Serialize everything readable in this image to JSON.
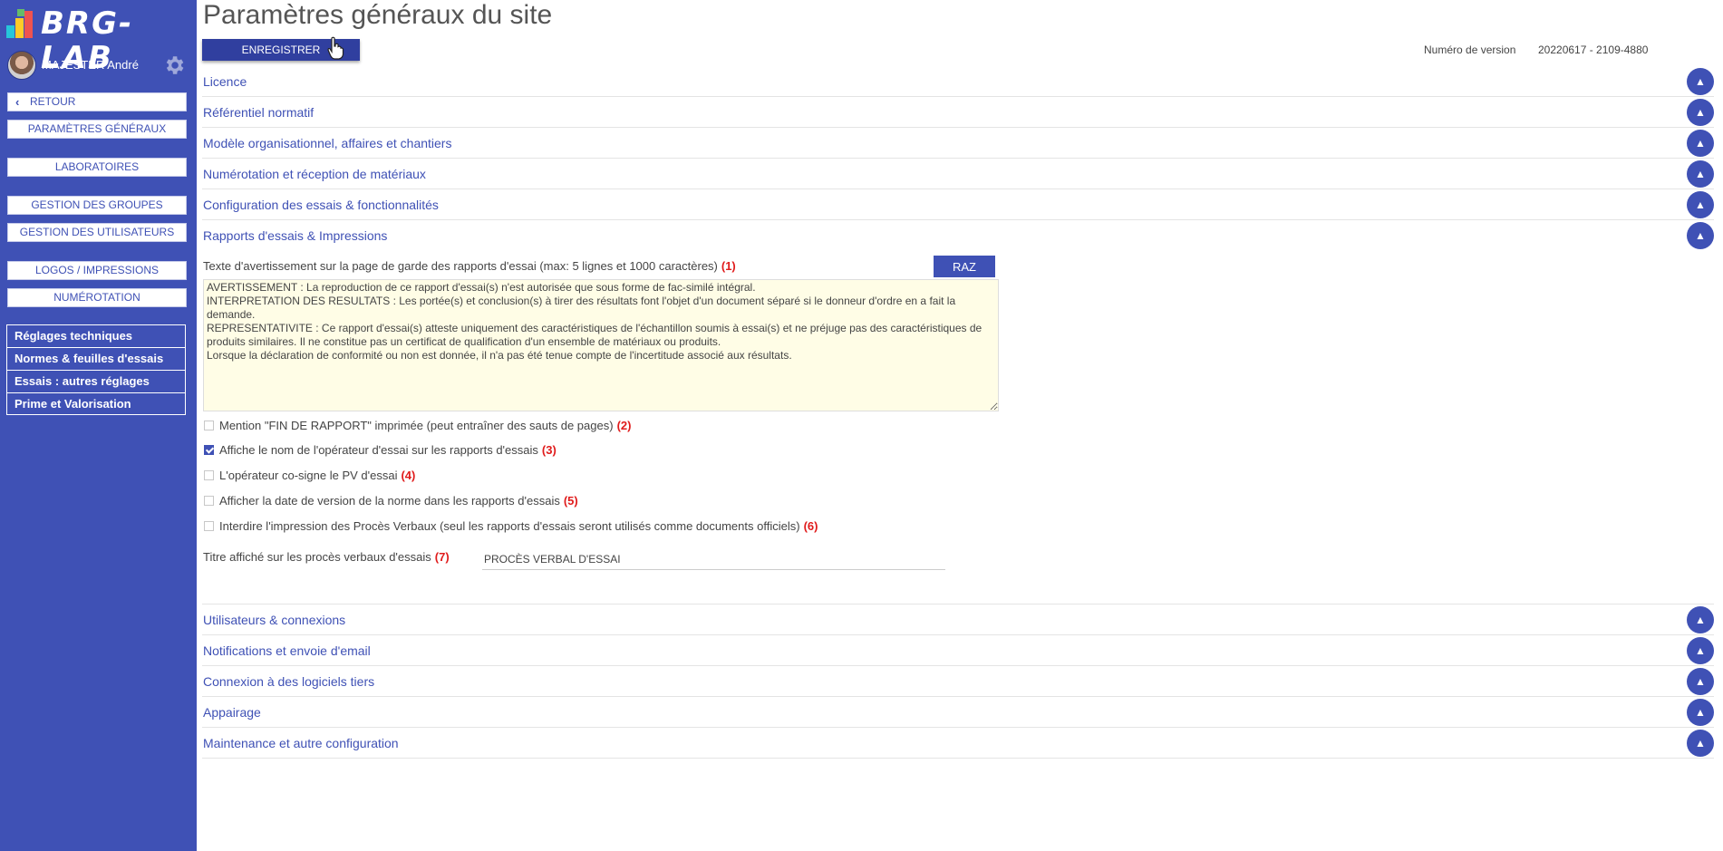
{
  "sidebar": {
    "logo_text": "BRG-LAB",
    "user_name": "MAJESTER André",
    "back_label": "RETOUR",
    "buttons": [
      {
        "label": "PARAMÈTRES GÉNÉRAUX"
      },
      {
        "label": "LABORATOIRES"
      },
      {
        "label": "GESTION DES GROUPES"
      },
      {
        "label": "GESTION DES UTILISATEURS"
      },
      {
        "label": "LOGOS / IMPRESSIONS"
      },
      {
        "label": "NUMÉROTATION"
      }
    ],
    "box_items": [
      {
        "label": "Réglages techniques"
      },
      {
        "label": "Normes & feuilles d'essais"
      },
      {
        "label": "Essais : autres réglages"
      },
      {
        "label": "Prime et Valorisation"
      }
    ]
  },
  "header": {
    "title": "Paramètres généraux du site",
    "save_label": "ENREGISTRER",
    "version_label": "Numéro de version",
    "version_value": "20220617 - 2109-4880"
  },
  "sections_top": [
    {
      "title": "Licence"
    },
    {
      "title": "Référentiel normatif"
    },
    {
      "title": "Modèle organisationnel, affaires et chantiers"
    },
    {
      "title": "Numérotation et réception de matériaux"
    },
    {
      "title": "Configuration des essais & fonctionnalités"
    }
  ],
  "open_section": {
    "title": "Rapports d'essais & Impressions",
    "warning_label": "Texte d'avertissement sur la page de garde des rapports d'essai (max: 5 lignes et 1000 caractères)",
    "warning_note": "(1)",
    "raz_label": "RAZ",
    "warning_text": "AVERTISSEMENT : La reproduction de ce rapport d'essai(s) n'est autorisée que sous forme de fac-similé intégral.\nINTERPRETATION DES RESULTATS : Les portée(s) et conclusion(s) à tirer des résultats font l'objet d'un document séparé si le donneur d'ordre en a fait la demande.\nREPRESENTATIVITE : Ce rapport d'essai(s) atteste uniquement des caractéristiques de l'échantillon soumis à essai(s) et ne préjuge pas des caractéristiques de produits similaires. Il ne constitue pas un certificat de qualification d'un ensemble de matériaux ou produits.\nLorsque la déclaration de conformité ou non est donnée, il n'a pas été tenue compte de l'incertitude associé aux résultats.",
    "checkboxes": [
      {
        "label": "Mention \"FIN DE RAPPORT\" imprimée (peut entraîner des sauts de pages)",
        "note": "(2)",
        "checked": false
      },
      {
        "label": "Affiche le nom de l'opérateur d'essai sur les rapports d'essais",
        "note": "(3)",
        "checked": true
      },
      {
        "label": "L'opérateur co-signe le PV d'essai",
        "note": "(4)",
        "checked": false
      },
      {
        "label": "Afficher la date de version de la norme dans les rapports d'essais",
        "note": "(5)",
        "checked": false
      },
      {
        "label": "Interdire l'impression des Procès Verbaux (seul les rapports d'essais seront utilisés comme documents officiels)",
        "note": "(6)",
        "checked": false
      }
    ],
    "pv_title_label": "Titre affiché sur les procès verbaux d'essais",
    "pv_title_note": "(7)",
    "pv_title_value": "PROCÈS VERBAL D'ESSAI"
  },
  "sections_bottom": [
    {
      "title": "Utilisateurs & connexions"
    },
    {
      "title": "Notifications et envoie d'email"
    },
    {
      "title": "Connexion à des logiciels tiers"
    },
    {
      "title": "Appairage"
    },
    {
      "title": "Maintenance et autre configuration"
    }
  ],
  "toggle_glyph": "▲",
  "colors": {
    "primary": "#3f51b5",
    "primary_dark": "#303f9f",
    "note_red": "#e01b1b",
    "textarea_bg": "#fffde6"
  }
}
